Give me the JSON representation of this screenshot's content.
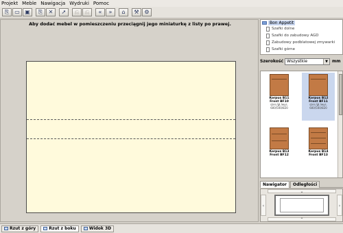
{
  "menubar": {
    "items": [
      "Projekt",
      "Meble",
      "Nawigacja",
      "Wydruki",
      "Pomoc"
    ]
  },
  "toolbar": {
    "buttons": [
      {
        "icon": "new-document-icon",
        "glyph": "⎘"
      },
      {
        "icon": "open-folder-icon",
        "glyph": "▭"
      },
      {
        "icon": "save-icon",
        "glyph": "▣"
      },
      {
        "icon": "copy-icon",
        "glyph": "⎘"
      },
      {
        "icon": "delete-icon",
        "glyph": "✕"
      },
      {
        "icon": "pointer-icon",
        "glyph": "➚"
      },
      {
        "icon": "undo-icon",
        "glyph": "⎌"
      },
      {
        "icon": "redo-icon",
        "glyph": "⎌"
      },
      {
        "icon": "rewind-icon",
        "glyph": "«"
      },
      {
        "icon": "fast-forward-icon",
        "glyph": "»"
      },
      {
        "icon": "home-icon",
        "glyph": "⌂"
      },
      {
        "icon": "tool-icon",
        "glyph": "⚒"
      },
      {
        "icon": "settings-icon",
        "glyph": "⚙"
      }
    ]
  },
  "canvas": {
    "hint": "Aby dodać mebel w pomieszczeniu przeciągnij jego miniaturkę z listy po prawej."
  },
  "tree": {
    "root": "Bon Appetit",
    "children": [
      "Szafki dolne",
      "Szafki do zabudowy AGD",
      "Zabudowy podblatowej zmywarki",
      "Szafki górne"
    ]
  },
  "filter": {
    "label": "Szerokość",
    "value": "Wszystkie",
    "unit": "mm"
  },
  "catalog": {
    "items": [
      {
        "name": "Korpus B11",
        "front": "Front BF10",
        "dims": "szer./gł./wys.",
        "size": "600/500/820",
        "selected": false
      },
      {
        "name": "Korpus B12",
        "front": "Front BF11",
        "dims": "szer./gł./wys.",
        "size": "600/500/820",
        "selected": true
      },
      {
        "name": "Korpus B13",
        "front": "Front BF12",
        "dims": "",
        "size": "",
        "selected": false
      },
      {
        "name": "Korpus B14",
        "front": "Front BF13",
        "dims": "",
        "size": "",
        "selected": false
      }
    ]
  },
  "panel_tabs": [
    "Nawigator",
    "Odległości"
  ],
  "view_tabs": [
    "Rzut z góry",
    "Rzut z boku",
    "Widok 3D"
  ]
}
